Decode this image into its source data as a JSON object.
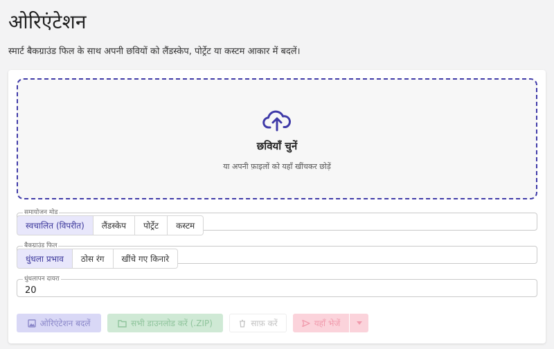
{
  "header": {
    "title": "ओरिएंटेशन",
    "subtitle": "स्मार्ट बैकग्राउंड फिल के साथ अपनी छवियों को लैंडस्केप, पोर्ट्रेट या कस्टम आकार में बदलें।"
  },
  "dropzone": {
    "title": "छवियाँ चुनें",
    "hint": "या अपनी फ़ाइलों को यहाँ खींचकर छोड़ें",
    "icon": "cloud-upload-icon",
    "accent": "#3f3aa8"
  },
  "mode": {
    "label": "समायोजन मोड",
    "options": [
      "स्वचालित (विपरीत)",
      "लैंडस्केप",
      "पोर्ट्रेट",
      "कस्टम"
    ],
    "selected": "स्वचालित (विपरीत)"
  },
  "background": {
    "label": "बैकग्राउंड फिल",
    "options": [
      "धुंधला प्रभाव",
      "ठोस रंग",
      "खींचे गए किनारे"
    ],
    "selected": "धुंधला प्रभाव"
  },
  "blur": {
    "label": "धुंधलापन दायरा",
    "value": "20"
  },
  "actions": {
    "change": "ओरिएंटेशन बदलें",
    "download_all": "सभी डाउनलोड करें (.ZIP)",
    "clear": "साफ़ करें",
    "send_here": "यहाँ भेजें"
  }
}
